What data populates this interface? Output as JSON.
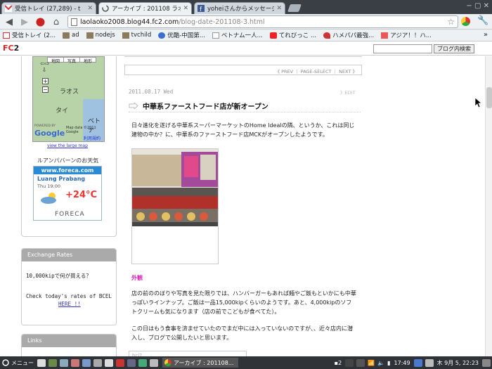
{
  "tabs": [
    {
      "label": "受信トレイ (27,289) - t",
      "active": false
    },
    {
      "label": "アーカイブ : 201108 ラオ",
      "active": true
    },
    {
      "label": "yoheiさんからメッセージ",
      "active": false
    }
  ],
  "address": {
    "host": "laolaoko2008.blog44.fc2.com",
    "path": "/blog-date-201108-3.html"
  },
  "bookmarks": [
    "受信トレイ (2...",
    "ad",
    "nodejs",
    "tvchild",
    "优酷-中国第...",
    "ベトナム一人...",
    "てれびっこ ...",
    "ハメパパ最強...",
    "アジア！！ハ..."
  ],
  "fc2": {
    "logo_prefix": "FC",
    "logo_suffix": "2",
    "search_button": "ブログ内検索"
  },
  "sidebar": {
    "map": {
      "labels": [
        "ラオス",
        "タイ",
        "ベトナ"
      ],
      "powered": "POWERED BY",
      "google": "Google",
      "map_data": "Map data ©2011 Google",
      "terms": "利用規約",
      "map_buttons": [
        "地図",
        "写真",
        "地形"
      ]
    },
    "view_large_map": "view the large map",
    "weather": {
      "title": "ルアンパバーンのお天気",
      "site": "www.foreca.com",
      "city": "Luang Prabang",
      "time": "Thu 19:00",
      "temp": "+24°C",
      "brand": "FORECA"
    },
    "exchange": {
      "header": "Exchange Rates",
      "question": "10,000kipで何が買える？",
      "line": "Check today's rates of BCEL",
      "link": "HERE !!"
    },
    "links": {
      "header": "Links"
    }
  },
  "post": {
    "nav": "《 PREV ｜ PAGE-SELECT ｜ NEXT 》",
    "date": "2011.08.17 Wed",
    "edit": "》EDIT",
    "title": "中華系ファーストフード店が新オープン",
    "para1": "日々進化を遂げる中華系スーパーマーケットのHome Idealの隣、というか、これは同じ建物の中か？に、中華系のファーストフード店MCKがオープンしたようです。",
    "subhead": "外観",
    "para2": "店の前ののぼりや写真を見た限りでは、ハンバーガーもあれば麺やご飯もといかにも中華っぽいラインナップ。ご飯は一品15,000kipくらいのようです。あと、4,000kipのソフトクリームも気になります（店の前でこどもが食べてた）。",
    "para3": "この日はもう食事を済ませていたのでまだ中には入っていないのですが、、近々店内に潜入し、ブログで公開したいと思います。",
    "cut_label": "bcl?"
  },
  "taskbar": {
    "menu": "メニュー",
    "window": "アーカイブ : 201108...",
    "badge": "2",
    "time": "17:49",
    "date": "木 9月 5, 22:23"
  },
  "colors": {
    "accent": "#e020c0",
    "weather_blue": "#2a8ad6"
  }
}
